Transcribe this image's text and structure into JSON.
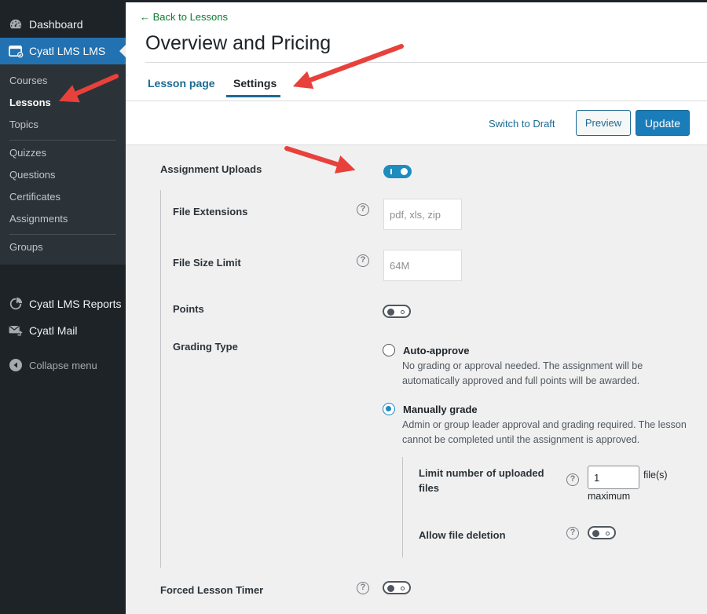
{
  "sidebar": {
    "dashboard": "Dashboard",
    "lms": "Cyatl LMS LMS",
    "submenu": {
      "group1": [
        "Courses",
        "Lessons",
        "Topics"
      ],
      "group2": [
        "Quizzes",
        "Questions",
        "Certificates",
        "Assignments"
      ],
      "group3": [
        "Groups"
      ]
    },
    "reports": "Cyatl LMS Reports",
    "mail": "Cyatl Mail",
    "collapse": "Collapse menu"
  },
  "header": {
    "back_link": "← Back to Lessons",
    "title": "Overview and Pricing",
    "tabs": [
      "Lesson page",
      "Settings"
    ],
    "switch_draft": "Switch to Draft",
    "preview": "Preview",
    "update": "Update"
  },
  "settings": {
    "assignment_uploads": {
      "label": "Assignment Uploads",
      "enabled": true
    },
    "file_extensions": {
      "label": "File Extensions",
      "placeholder": "pdf, xls, zip"
    },
    "file_size_limit": {
      "label": "File Size Limit",
      "placeholder": "64M"
    },
    "points": {
      "label": "Points",
      "enabled": false
    },
    "grading_type": {
      "label": "Grading Type",
      "auto_title": "Auto-approve",
      "auto_desc_1": "No grading or approval needed. The assignment will be",
      "auto_desc_2": "automatically approved and full points will be awarded.",
      "manual_title": "Manually grade",
      "manual_desc_1": "Admin or group leader approval and grading required. The lesson",
      "manual_desc_2": "cannot be completed until the assignment is approved.",
      "selected": "Manually grade"
    },
    "limit_files": {
      "label_1": "Limit number of uploaded",
      "label_2": "files",
      "value": "1",
      "unit": "file(s)",
      "suffix": "maximum"
    },
    "allow_deletion": {
      "label": "Allow file deletion",
      "enabled": false
    },
    "forced_timer": {
      "label": "Forced Lesson Timer",
      "enabled": false
    }
  },
  "help_glyph": "?",
  "colors": {
    "accent": "#1e8cbe",
    "sidebar_bg": "#1d2327",
    "sidebar_active": "#2271b1",
    "annotation_arrow": "#e8413b"
  },
  "icons": [
    "dashboard-icon",
    "lms-icon",
    "reports-icon",
    "mail-icon",
    "collapse-icon",
    "help-icon",
    "red-arrow-annotation"
  ]
}
